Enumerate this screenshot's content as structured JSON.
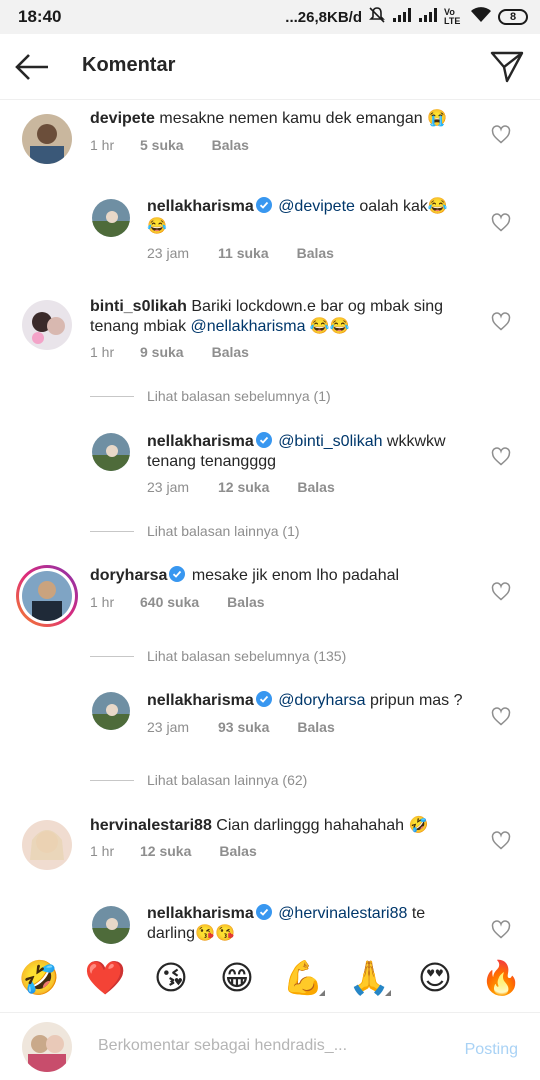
{
  "status_bar": {
    "time": "18:40",
    "network": "...26,8KB/d",
    "volte": "Vo LTE",
    "battery": "8"
  },
  "header": {
    "title": "Komentar"
  },
  "comments": [
    {
      "user": "devipete",
      "text": "mesakne nemen kamu dek emangan 😭",
      "time": "1 hr",
      "likes": "5 suka",
      "reply": "Balas"
    },
    {
      "user": "nellakharisma",
      "mention": "@devipete",
      "text": " oalah kak😂😂",
      "time": "23 jam",
      "likes": "11 suka",
      "reply": "Balas"
    },
    {
      "user": "binti_s0likah",
      "text": "Bariki lockdown.e bar og mbak sing tenang mbiak ",
      "mention": "@nellakharisma",
      "text_after": " 😂😂",
      "time": "1 hr",
      "likes": "9 suka",
      "reply": "Balas"
    },
    {
      "view_prev": "Lihat balasan sebelumnya (1)"
    },
    {
      "user": "nellakharisma",
      "mention": "@binti_s0likah",
      "text": " wkkwkw tenang tenangggg",
      "time": "23 jam",
      "likes": "12 suka",
      "reply": "Balas"
    },
    {
      "view_more": "Lihat balasan lainnya (1)"
    },
    {
      "user": "doryharsa",
      "text": " mesake jik enom lho padahal",
      "time": "1 hr",
      "likes": "640 suka",
      "reply": "Balas"
    },
    {
      "view_prev": "Lihat balasan sebelumnya (135)"
    },
    {
      "user": "nellakharisma",
      "mention": "@doryharsa",
      "text": " pripun mas ?",
      "time": "23 jam",
      "likes": "93 suka",
      "reply": "Balas"
    },
    {
      "view_more": "Lihat balasan lainnya (62)"
    },
    {
      "user": "hervinalestari88",
      "text": " Cian darlinggg hahahahah 🤣",
      "time": "1 hr",
      "likes": "12 suka",
      "reply": "Balas"
    },
    {
      "user": "nellakharisma",
      "mention": "@hervinalestari88",
      "text": " te darling😘😘"
    }
  ],
  "emoji_bar": [
    "🤣",
    "❤️",
    "😘",
    "😁",
    "💪",
    "🙏",
    "😍",
    "🔥"
  ],
  "composer": {
    "placeholder": "Berkomentar sebagai hendradis_...",
    "post_label": "Posting"
  },
  "colors": {
    "accent_blue": "#3897f0",
    "mention": "#00376b",
    "muted": "#8e8e8e"
  }
}
